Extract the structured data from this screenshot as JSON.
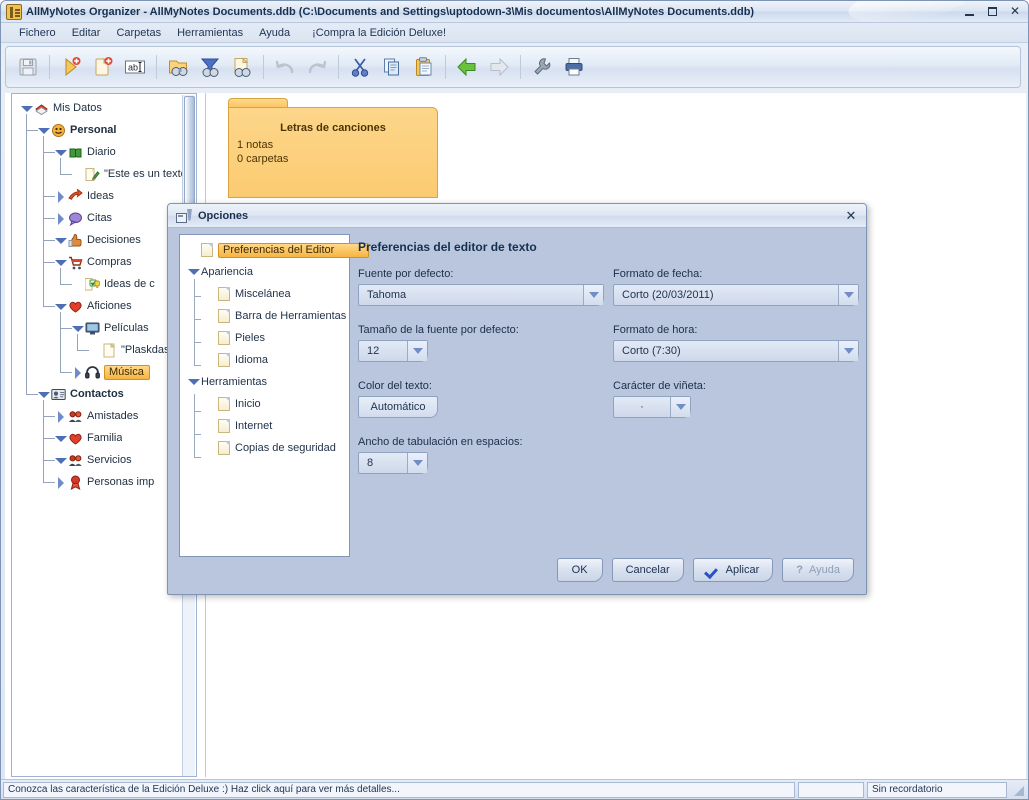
{
  "window": {
    "title": "AllMyNotes Organizer - AllMyNotes Documents.ddb (C:\\Documents and Settings\\uptodown-3\\Mis documentos\\AllMyNotes Documents.ddb)",
    "app_icon": "notebook-icon",
    "buttons": {
      "minimize": "minimize-icon",
      "maximize": "maximize-icon",
      "close": "close-icon"
    }
  },
  "menu": {
    "items": [
      {
        "label": "Fichero"
      },
      {
        "label": "Editar"
      },
      {
        "label": "Carpetas"
      },
      {
        "label": "Herramientas"
      },
      {
        "label": "Ayuda"
      },
      {
        "label": "¡Compra la Edición Deluxe!"
      }
    ]
  },
  "toolbar": {
    "buttons": [
      {
        "name": "save-icon",
        "glyph": "save",
        "enabled": false
      },
      {
        "name": "new-note-icon",
        "glyph": "new-note",
        "enabled": true
      },
      {
        "name": "new-folder-icon",
        "glyph": "new-folder",
        "enabled": true
      },
      {
        "name": "rename-icon",
        "glyph": "rename",
        "enabled": true
      },
      {
        "name": "find-folder-icon",
        "glyph": "find-folder",
        "enabled": true
      },
      {
        "name": "filter-icon",
        "glyph": "filter",
        "enabled": true
      },
      {
        "name": "find-note-icon",
        "glyph": "find-note",
        "enabled": true
      },
      {
        "name": "undo-icon",
        "glyph": "undo",
        "enabled": false
      },
      {
        "name": "redo-icon",
        "glyph": "redo",
        "enabled": false
      },
      {
        "name": "cut-icon",
        "glyph": "cut",
        "enabled": true
      },
      {
        "name": "copy-icon",
        "glyph": "copy",
        "enabled": true
      },
      {
        "name": "paste-icon",
        "glyph": "paste",
        "enabled": true
      },
      {
        "name": "back-icon",
        "glyph": "back",
        "enabled": true
      },
      {
        "name": "forward-icon",
        "glyph": "forward",
        "enabled": false
      },
      {
        "name": "settings-wrench-icon",
        "glyph": "wrench",
        "enabled": true
      },
      {
        "name": "print-icon",
        "glyph": "print",
        "enabled": true
      }
    ]
  },
  "tree": {
    "items": [
      {
        "label": "Mis Datos",
        "depth": 0,
        "twisty": "open",
        "icon": "books-icon",
        "bold": false,
        "selected": false
      },
      {
        "label": "Personal",
        "depth": 1,
        "twisty": "open",
        "icon": "smiley-icon",
        "bold": true,
        "selected": false
      },
      {
        "label": "Diario",
        "depth": 2,
        "twisty": "open",
        "icon": "green-book-icon",
        "bold": false,
        "selected": false
      },
      {
        "label": "\"Este es un texto de",
        "depth": 3,
        "twisty": "none",
        "icon": "note-pencil-icon",
        "bold": false,
        "selected": false
      },
      {
        "label": "Ideas",
        "depth": 2,
        "twisty": "closed",
        "icon": "arrow-red-icon",
        "bold": false,
        "selected": false
      },
      {
        "label": "Citas",
        "depth": 2,
        "twisty": "closed",
        "icon": "speech-icon",
        "bold": false,
        "selected": false
      },
      {
        "label": "Decisiones",
        "depth": 2,
        "twisty": "open",
        "icon": "thumb-icon",
        "bold": false,
        "selected": false
      },
      {
        "label": "Compras",
        "depth": 2,
        "twisty": "open",
        "icon": "cart-icon",
        "bold": false,
        "selected": false
      },
      {
        "label": "Ideas de c",
        "depth": 3,
        "twisty": "none",
        "icon": "note-check-bulb-icon",
        "bold": false,
        "selected": false
      },
      {
        "label": "Aficiones",
        "depth": 2,
        "twisty": "open",
        "icon": "heart-icon",
        "bold": false,
        "selected": false
      },
      {
        "label": "Películas",
        "depth": 3,
        "twisty": "open",
        "icon": "monitor-icon",
        "bold": false,
        "selected": false
      },
      {
        "label": "\"Plaskdasd\"",
        "depth": 4,
        "twisty": "none",
        "icon": "note-icon",
        "bold": false,
        "selected": false
      },
      {
        "label": "Música",
        "depth": 3,
        "twisty": "closed",
        "icon": "headphones-icon",
        "bold": false,
        "selected": true
      },
      {
        "label": "Contactos",
        "depth": 1,
        "twisty": "open",
        "icon": "contacts-icon",
        "bold": true,
        "selected": false
      },
      {
        "label": "Amistades",
        "depth": 2,
        "twisty": "closed",
        "icon": "friends-icon",
        "bold": false,
        "selected": false
      },
      {
        "label": "Familia",
        "depth": 2,
        "twisty": "open",
        "icon": "heart-icon",
        "bold": false,
        "selected": false
      },
      {
        "label": "Servicios",
        "depth": 2,
        "twisty": "open",
        "icon": "friends-icon",
        "bold": false,
        "selected": false
      },
      {
        "label": "Personas imp",
        "depth": 2,
        "twisty": "closed",
        "icon": "award-icon",
        "bold": false,
        "selected": false
      }
    ]
  },
  "main": {
    "folder_card": {
      "title": "Letras de canciones",
      "notes": "1 notas",
      "folders": "0 carpetas"
    }
  },
  "dialog": {
    "title": "Opciones",
    "close_label": "✕",
    "nav": [
      {
        "label": "Preferencias del Editor",
        "depth": 0,
        "twisty": "none",
        "selected": true,
        "type": "page"
      },
      {
        "label": "Apariencia",
        "depth": 0,
        "twisty": "open",
        "selected": false,
        "type": "group"
      },
      {
        "label": "Miscelánea",
        "depth": 1,
        "twisty": "none",
        "selected": false,
        "type": "page"
      },
      {
        "label": "Barra de Herramientas",
        "depth": 1,
        "twisty": "none",
        "selected": false,
        "type": "page"
      },
      {
        "label": "Pieles",
        "depth": 1,
        "twisty": "none",
        "selected": false,
        "type": "page"
      },
      {
        "label": "Idioma",
        "depth": 1,
        "twisty": "none",
        "selected": false,
        "type": "page"
      },
      {
        "label": "Herramientas",
        "depth": 0,
        "twisty": "open",
        "selected": false,
        "type": "group"
      },
      {
        "label": "Inicio",
        "depth": 1,
        "twisty": "none",
        "selected": false,
        "type": "page"
      },
      {
        "label": "Internet",
        "depth": 1,
        "twisty": "none",
        "selected": false,
        "type": "page"
      },
      {
        "label": "Copias de seguridad",
        "depth": 1,
        "twisty": "none",
        "selected": false,
        "type": "page"
      }
    ],
    "panel": {
      "heading": "Preferencias del editor de texto",
      "fields": {
        "default_font": {
          "label": "Fuente por defecto:",
          "value": "Tahoma"
        },
        "default_size": {
          "label": "Tamaño de la fuente por defecto:",
          "value": "12"
        },
        "text_color": {
          "label": "Color del texto:",
          "value": "Automático"
        },
        "tab_width": {
          "label": "Ancho de tabulación en espacios:",
          "value": "8"
        },
        "date_format": {
          "label": "Formato de fecha:",
          "value": "Corto (20/03/2011)"
        },
        "time_format": {
          "label": "Formato de hora:",
          "value": "Corto (7:30)"
        },
        "bullet_char": {
          "label": "Carácter de viñeta:",
          "value": "·"
        }
      }
    },
    "buttons": [
      {
        "label": "OK",
        "name": "ok-button",
        "icon": "",
        "disabled": false
      },
      {
        "label": "Cancelar",
        "name": "cancel-button",
        "icon": "",
        "disabled": false
      },
      {
        "label": "Aplicar",
        "name": "apply-button",
        "icon": "check-icon",
        "disabled": false
      },
      {
        "label": "Ayuda",
        "name": "help-button",
        "icon": "question-icon",
        "disabled": true
      }
    ]
  },
  "status_bar": {
    "message": "Conozca las característica de la Edición Deluxe :) Haz click aquí para ver más detalles...",
    "middle": "",
    "reminder": "Sin recordatorio"
  },
  "colors": {
    "accent_orange": "#f7b441",
    "dialog_bg": "#b9c6de",
    "title_text": "#17304f",
    "tree_line": "#93a4ba"
  }
}
